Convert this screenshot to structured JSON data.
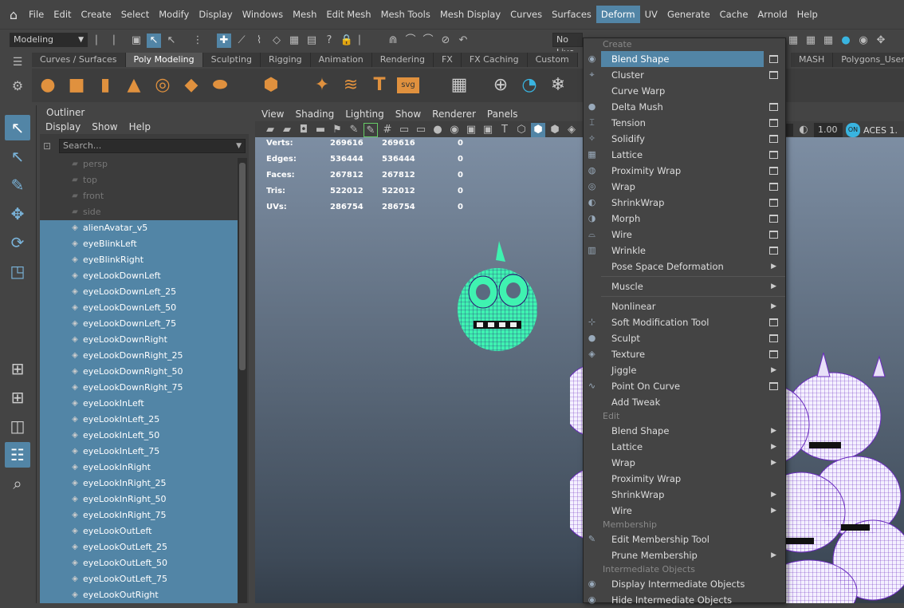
{
  "menubar": {
    "items": [
      "File",
      "Edit",
      "Create",
      "Select",
      "Modify",
      "Display",
      "Windows",
      "Mesh",
      "Edit Mesh",
      "Mesh Tools",
      "Mesh Display",
      "Curves",
      "Surfaces",
      "Deform",
      "UV",
      "Generate",
      "Cache",
      "Arnold",
      "Help"
    ],
    "active": "Deform"
  },
  "statusline": {
    "mode": "Modeling",
    "no_live": "No Live",
    "value": "1.00",
    "color_space": "ACES 1."
  },
  "shelf": {
    "tabs": [
      "Curves / Surfaces",
      "Poly Modeling",
      "Sculpting",
      "Rigging",
      "Animation",
      "Rendering",
      "FX",
      "FX Caching",
      "Custom"
    ],
    "active": "Poly Modeling",
    "right_tabs": [
      "MASH",
      "Polygons_User"
    ]
  },
  "outliner": {
    "title": "Outliner",
    "menu": [
      "Display",
      "Show",
      "Help"
    ],
    "search_placeholder": "Search...",
    "cameras": [
      "persp",
      "top",
      "front",
      "side"
    ],
    "items": [
      "alienAvatar_v5",
      "eyeBlinkLeft",
      "eyeBlinkRight",
      "eyeLookDownLeft",
      "eyeLookDownLeft_25",
      "eyeLookDownLeft_50",
      "eyeLookDownLeft_75",
      "eyeLookDownRight",
      "eyeLookDownRight_25",
      "eyeLookDownRight_50",
      "eyeLookDownRight_75",
      "eyeLookInLeft",
      "eyeLookInLeft_25",
      "eyeLookInLeft_50",
      "eyeLookInLeft_75",
      "eyeLookInRight",
      "eyeLookInRight_25",
      "eyeLookInRight_50",
      "eyeLookInRight_75",
      "eyeLookOutLeft",
      "eyeLookOutLeft_25",
      "eyeLookOutLeft_50",
      "eyeLookOutLeft_75",
      "eyeLookOutRight"
    ]
  },
  "viewport": {
    "menu": [
      "View",
      "Shading",
      "Lighting",
      "Show",
      "Renderer",
      "Panels"
    ],
    "hud": [
      {
        "label": "Verts:",
        "a": "269616",
        "b": "269616",
        "c": "0"
      },
      {
        "label": "Edges:",
        "a": "536444",
        "b": "536444",
        "c": "0"
      },
      {
        "label": "Faces:",
        "a": "267812",
        "b": "267812",
        "c": "0"
      },
      {
        "label": "Tris:",
        "a": "522012",
        "b": "522012",
        "c": "0"
      },
      {
        "label": "UVs:",
        "a": "286754",
        "b": "286754",
        "c": "0"
      }
    ]
  },
  "deform_menu": {
    "sections": {
      "create": "Create",
      "edit": "Edit",
      "membership": "Membership",
      "intermediate": "Intermediate Objects"
    },
    "create_items": [
      {
        "label": "Blend Shape",
        "opt": "box",
        "hl": true
      },
      {
        "label": "Cluster",
        "opt": "box"
      },
      {
        "label": "Curve Warp",
        "opt": ""
      },
      {
        "label": "Delta Mush",
        "opt": "box"
      },
      {
        "label": "Tension",
        "opt": "box"
      },
      {
        "label": "Solidify",
        "opt": "box"
      },
      {
        "label": "Lattice",
        "opt": "box"
      },
      {
        "label": "Proximity Wrap",
        "opt": "box"
      },
      {
        "label": "Wrap",
        "opt": "box"
      },
      {
        "label": "ShrinkWrap",
        "opt": "box"
      },
      {
        "label": "Morph",
        "opt": "box"
      },
      {
        "label": "Wire",
        "opt": "box"
      },
      {
        "label": "Wrinkle",
        "opt": "box"
      },
      {
        "label": "Pose Space Deformation",
        "opt": "arrow"
      }
    ],
    "create_items2": [
      {
        "label": "Muscle",
        "opt": "arrow"
      }
    ],
    "create_items3": [
      {
        "label": "Nonlinear",
        "opt": "arrow"
      },
      {
        "label": "Soft Modification Tool",
        "opt": "box"
      },
      {
        "label": "Sculpt",
        "opt": "box"
      },
      {
        "label": "Texture",
        "opt": "box"
      },
      {
        "label": "Jiggle",
        "opt": "arrow"
      },
      {
        "label": "Point On Curve",
        "opt": "box"
      },
      {
        "label": "Add Tweak",
        "opt": ""
      }
    ],
    "edit_items": [
      {
        "label": "Blend Shape",
        "opt": "arrow"
      },
      {
        "label": "Lattice",
        "opt": "arrow"
      },
      {
        "label": "Wrap",
        "opt": "arrow"
      },
      {
        "label": "Proximity Wrap",
        "opt": ""
      },
      {
        "label": "ShrinkWrap",
        "opt": "arrow"
      },
      {
        "label": "Wire",
        "opt": "arrow"
      }
    ],
    "membership_items": [
      {
        "label": "Edit Membership Tool",
        "opt": ""
      },
      {
        "label": "Prune Membership",
        "opt": "arrow"
      }
    ],
    "intermediate_items": [
      {
        "label": "Display Intermediate Objects",
        "opt": ""
      },
      {
        "label": "Hide Intermediate Objects",
        "opt": ""
      }
    ]
  },
  "colors": {
    "accent": "#5285a6",
    "mesh_green": "#3ff2b0",
    "mesh_purple": "#6a2bbf"
  }
}
